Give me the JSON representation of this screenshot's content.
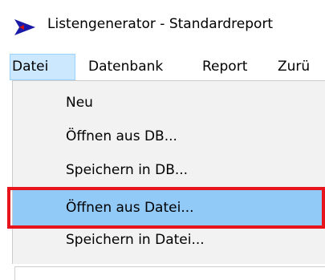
{
  "window": {
    "title": "Listengenerator - Standardreport"
  },
  "menubar": {
    "items": [
      {
        "label": "Datei"
      },
      {
        "label": "Datenbank"
      },
      {
        "label": "Report"
      },
      {
        "label": "Zurü"
      }
    ]
  },
  "dropdown": {
    "items": [
      {
        "label": "Neu"
      },
      {
        "label": "Öffnen aus DB..."
      },
      {
        "label": "Speichern in DB..."
      },
      {
        "label": "Öffnen aus Datei..."
      },
      {
        "label": "Speichern in Datei..."
      }
    ],
    "hovered_item": "Öffnen aus Datei..."
  },
  "colors": {
    "menu_active_bg": "#cce8ff",
    "menu_active_border": "#99d1ff",
    "dropdown_bg": "#f2f2f2",
    "hover_bg": "#91c9f7",
    "annotation_red": "#e8141c",
    "icon_blue": "#1a1aa8",
    "icon_red": "#d01010"
  },
  "icons": {
    "app": "app-play-icon"
  }
}
